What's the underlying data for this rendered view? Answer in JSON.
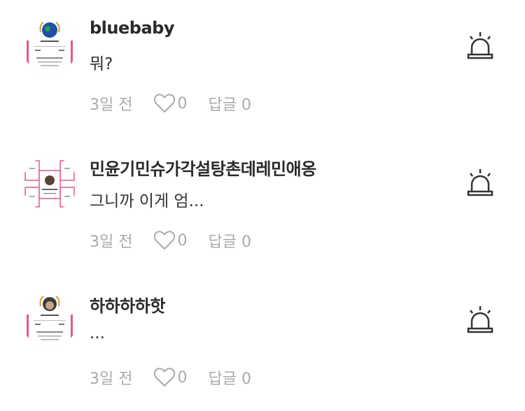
{
  "comments": [
    {
      "username": "bluebaby",
      "text": "뭐?",
      "time": "3일 전",
      "likes": "0",
      "reply_label": "답글 0",
      "avatar_icon": "profile-card-thumbnail"
    },
    {
      "username": "민윤기민슈가각설탕촌데레민애옹",
      "text": "그니까 이게 엄...",
      "time": "3일 전",
      "likes": "0",
      "reply_label": "답글 0",
      "avatar_icon": "profile-card-thumbnail"
    },
    {
      "username": "하하하하핫",
      "text": "...",
      "time": "3일 전",
      "likes": "0",
      "reply_label": "답글 0",
      "avatar_icon": "profile-card-thumbnail"
    }
  ],
  "colors": {
    "meta": "#aaaaaa",
    "name": "#2a2a2a",
    "icon": "#333333"
  },
  "icons": {
    "like": "heart-outline-icon",
    "report": "siren-icon"
  }
}
